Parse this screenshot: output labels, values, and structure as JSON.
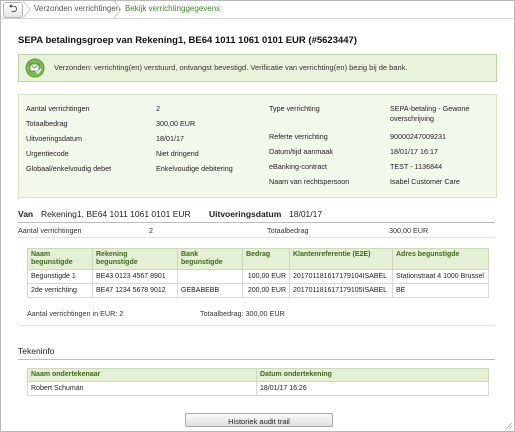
{
  "breadcrumb": {
    "back_symbol": "⮌",
    "items": [
      "Verzonden verrichtingen",
      "Bekijk verrichtinggegevens"
    ]
  },
  "page_title": "SEPA betalingsgroep van Rekening1, BE64 1011 1061 0101 EUR (#5623447)",
  "alert": {
    "text": "Verzonden: verrichting(en) verstuurd, ontvangst bevestigd. Verificatie van verrichting(en) bezig bij de bank."
  },
  "details": {
    "left": [
      {
        "label": "Aantal verrichtingen",
        "value": "2"
      },
      {
        "label": "Totaalbedrag",
        "value": "300,00 EUR"
      },
      {
        "label": "Uitvoeringsdatum",
        "value": "18/01/17"
      },
      {
        "label": "Urgentiecode",
        "value": "Niet dringend"
      },
      {
        "label": "Globaal/enkelvoudig debet",
        "value": "Enkelvoudige debitering"
      }
    ],
    "right": [
      {
        "label": "Type verrichting",
        "value": "SEPA-betaling - Gewone",
        "value2": "overschrijving"
      },
      {
        "label": "Referte verrichting",
        "value": "90000247009231"
      },
      {
        "label": "Datum/tijd aanmaak",
        "value": "18/01/17 16:17"
      },
      {
        "label": "eBanking-contract",
        "value": "TEST - 1136844"
      },
      {
        "label": "Naam van rechtspersoon",
        "value": "Isabel Customer Care"
      }
    ]
  },
  "van": {
    "label": "Van",
    "value": "Rekening1, BE64 1011 1061 0101 EUR",
    "date_label": "Uitvoeringsdatum",
    "date_value": "18/01/17"
  },
  "summary": {
    "count_label": "Aantal verrichtingen",
    "count_value": "2",
    "total_label": "Totaalbedrag",
    "total_value": "300,00 EUR"
  },
  "transactions": {
    "headers": [
      [
        "Naam",
        "begunstigde"
      ],
      [
        "Rekening",
        "begunstigde"
      ],
      [
        "Bank",
        "begunstigde"
      ],
      [
        "Bedrag",
        ""
      ],
      [
        "Klantenreferentie (E2E)",
        ""
      ],
      [
        "Adres begunstigde",
        ""
      ]
    ],
    "rows": [
      [
        "Begunstigde 1",
        "BE43 0123 4567 8901",
        "",
        "100,00 EUR",
        "20170118161717910​4ISABEL",
        "Stationstraat 4 1000 Brussel"
      ],
      [
        "2de verrichting",
        "BE47 1234 5678 9012",
        "GEBABEBB",
        "200,00 EUR",
        "201701181617179105ISABEL",
        "BE"
      ]
    ],
    "footer_count": "Aantal verrichtingen in EUR: 2",
    "footer_total": "Totaalbedrag: 300,00 EUR"
  },
  "tekeninfo": {
    "title": "Tekeninfo",
    "headers": [
      "Naam ondertekenaar",
      "Datum ondertekening"
    ],
    "rows": [
      [
        "Robert Schuman",
        "18/01/17 16:26"
      ]
    ]
  },
  "audit_button": "Historiek audit trail",
  "colors": {
    "accent_green": "#3b8a2c",
    "alert_bg": "#e9f3dc",
    "details_bg": "#f3f8ec",
    "header_bg": "#e4efd3"
  }
}
